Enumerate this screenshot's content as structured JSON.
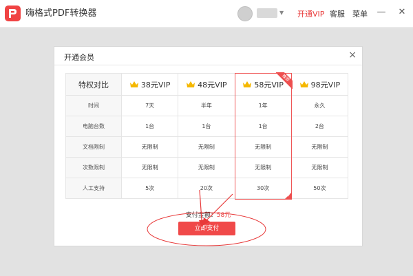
{
  "app": {
    "title": "嗨格式PDF转换器"
  },
  "header": {
    "caret": "▼",
    "nav": {
      "vip": "开通VIP",
      "service": "客服",
      "menu": "菜单"
    },
    "window": {
      "minimize": "—",
      "close": "✕"
    }
  },
  "dialog": {
    "title": "开通会员",
    "close": "×",
    "table": {
      "header_first": "特权对比",
      "plans": [
        "38元VIP",
        "48元VIP",
        "58元VIP",
        "98元VIP"
      ],
      "ribbon": "推荐",
      "rows": [
        {
          "label": "时间",
          "values": [
            "7天",
            "半年",
            "1年",
            "永久"
          ]
        },
        {
          "label": "电脑台数",
          "values": [
            "1台",
            "1台",
            "1台",
            "2台"
          ]
        },
        {
          "label": "文档限制",
          "values": [
            "无限制",
            "无限制",
            "无限制",
            "无限制"
          ]
        },
        {
          "label": "次数限制",
          "values": [
            "无限制",
            "无限制",
            "无限制",
            "无限制"
          ]
        },
        {
          "label": "人工支持",
          "values": [
            "5次",
            "20次",
            "30次",
            "50次"
          ]
        }
      ],
      "check": "✓"
    },
    "pay": {
      "label": "支付金额：",
      "amount": "58元",
      "button": "立即支付"
    }
  },
  "colors": {
    "accent": "#f04949",
    "crown": "#f5b800",
    "annotation": "#e83a3a"
  },
  "icons": {
    "logo": "pdf-logo-icon",
    "crown": "crown-icon",
    "close": "close-icon"
  }
}
